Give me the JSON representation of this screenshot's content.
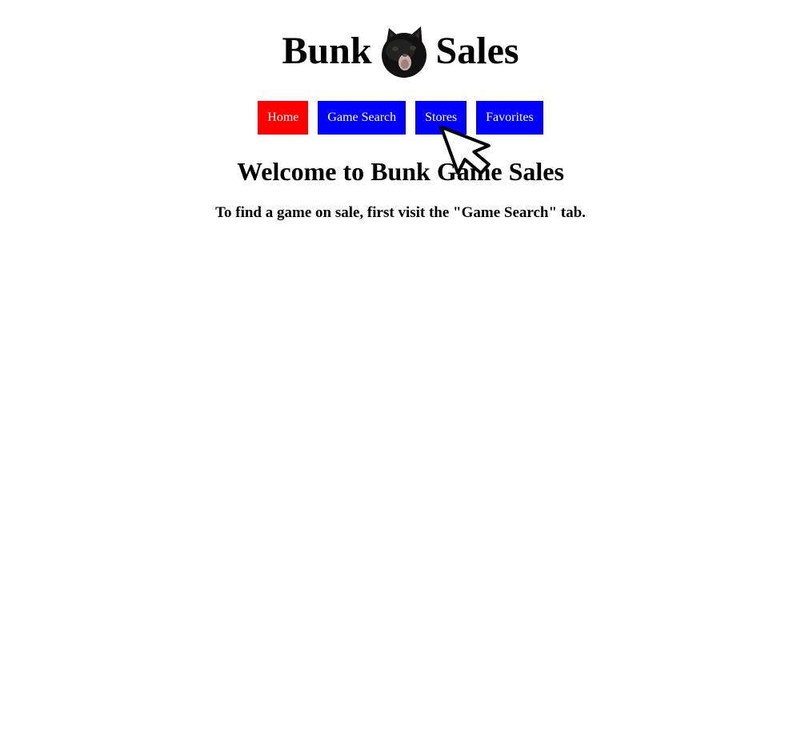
{
  "header": {
    "title_left": "Bunk",
    "title_right": "Sales",
    "logo_icon": "cat-face-icon"
  },
  "nav": {
    "items": [
      {
        "label": "Home",
        "active": true
      },
      {
        "label": "Game Search",
        "active": false
      },
      {
        "label": "Stores",
        "active": false
      },
      {
        "label": "Favorites",
        "active": false
      }
    ]
  },
  "main": {
    "heading": "Welcome to Bunk Game Sales",
    "instructions": "To find a game on sale, first visit the \"Game Search\" tab."
  },
  "colors": {
    "active_tab": "#ff0000",
    "inactive_tab": "#0000ff",
    "tab_text": "#ffffff"
  },
  "cursor_icon": "mouse-pointer-icon"
}
